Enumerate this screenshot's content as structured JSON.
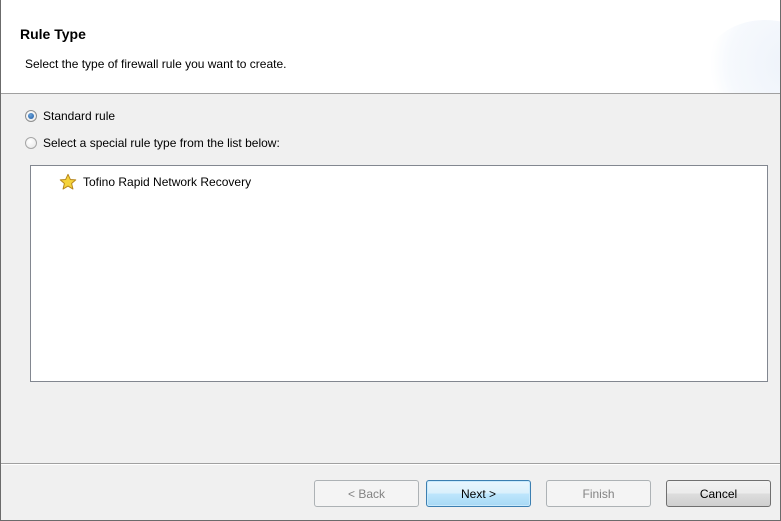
{
  "header": {
    "title": "Rule Type",
    "description": "Select the type of firewall rule you want to create."
  },
  "options": {
    "standard_label": "Standard rule",
    "special_label": "Select a special rule type from the list below:",
    "selected": "standard"
  },
  "rule_list": {
    "items": [
      {
        "label": "Tofino Rapid Network Recovery",
        "icon": "star-icon"
      }
    ]
  },
  "buttons": {
    "back": "< Back",
    "next": "Next >",
    "finish": "Finish",
    "cancel": "Cancel"
  },
  "colors": {
    "star_fill": "#f5d33a",
    "star_stroke": "#b7861b",
    "radio_selected": "#1d5aa5"
  }
}
